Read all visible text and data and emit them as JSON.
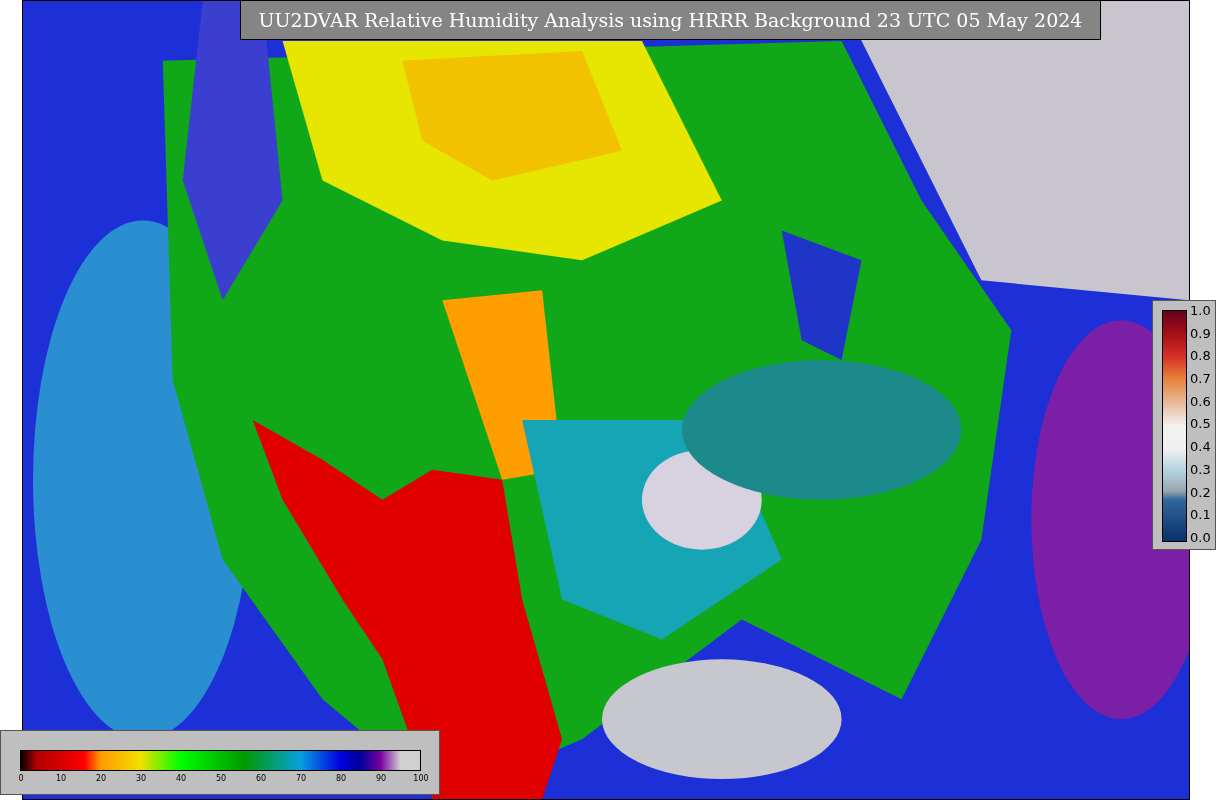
{
  "title": "UU2DVAR Relative Humidity Analysis using HRRR Background 23 UTC 05 May 2024",
  "fraction_colorbar": {
    "ticks": [
      "1.0",
      "0.9",
      "0.8",
      "0.7",
      "0.6",
      "0.5",
      "0.4",
      "0.3",
      "0.2",
      "0.1",
      "0.0"
    ]
  },
  "percent_colorbar": {
    "ticks": [
      "0",
      "10",
      "20",
      "30",
      "40",
      "50",
      "60",
      "70",
      "80",
      "90",
      "100"
    ]
  }
}
